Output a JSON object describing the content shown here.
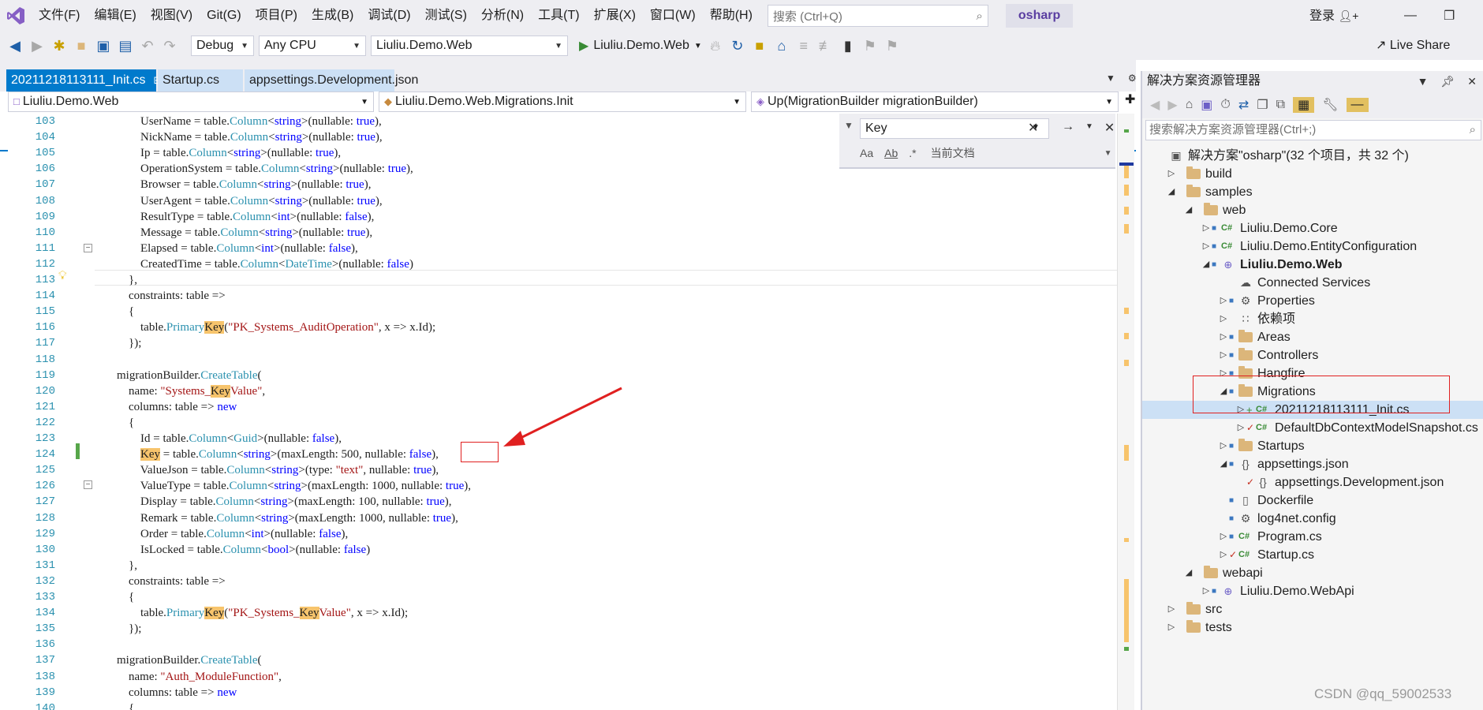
{
  "menu": {
    "items": [
      "文件(F)",
      "编辑(E)",
      "视图(V)",
      "Git(G)",
      "项目(P)",
      "生成(B)",
      "调试(D)",
      "测试(S)",
      "分析(N)",
      "工具(T)",
      "扩展(X)",
      "窗口(W)",
      "帮助(H)"
    ],
    "search_placeholder": "搜索 (Ctrl+Q)",
    "solution_name": "osharp",
    "login": "登录"
  },
  "toolbar": {
    "config": "Debug",
    "platform": "Any CPU",
    "startup_project": "Liuliu.Demo.Web",
    "run_target": "Liuliu.Demo.Web",
    "live_share": "Live Share"
  },
  "tabs": [
    {
      "label": "20211218113111_Init.cs",
      "active": true
    },
    {
      "label": "Startup.cs",
      "active": false
    },
    {
      "label": "appsettings.Development.json",
      "active": false
    }
  ],
  "navbar": {
    "project": "Liuliu.Demo.Web",
    "type": "Liuliu.Demo.Web.Migrations.Init",
    "member": "Up(MigrationBuilder migrationBuilder)"
  },
  "find": {
    "query": "Key",
    "scope": "当前文档"
  },
  "code": {
    "line_numbers": [
      "103",
      "104",
      "105",
      "106",
      "107",
      "108",
      "109",
      "110",
      "111",
      "112",
      "113",
      "114",
      "115",
      "116",
      "117",
      "118",
      "119",
      "120",
      "121",
      "122",
      "123",
      "124",
      "125",
      "126",
      "127",
      "128",
      "129",
      "130",
      "131",
      "132",
      "133",
      "134",
      "135",
      "136",
      "137",
      "138",
      "139",
      "140"
    ],
    "lines": [
      [
        {
          "t": "                UserName = table.",
          "c": ""
        },
        {
          "t": "Column",
          "c": "ty"
        },
        {
          "t": "<",
          "c": ""
        },
        {
          "t": "string",
          "c": "kw"
        },
        {
          "t": ">(nullable: ",
          "c": ""
        },
        {
          "t": "true",
          "c": "kw"
        },
        {
          "t": "),",
          "c": ""
        }
      ],
      [
        {
          "t": "                NickName = table.",
          "c": ""
        },
        {
          "t": "Column",
          "c": "ty"
        },
        {
          "t": "<",
          "c": ""
        },
        {
          "t": "string",
          "c": "kw"
        },
        {
          "t": ">(nullable: ",
          "c": ""
        },
        {
          "t": "true",
          "c": "kw"
        },
        {
          "t": "),",
          "c": ""
        }
      ],
      [
        {
          "t": "                Ip = table.",
          "c": ""
        },
        {
          "t": "Column",
          "c": "ty"
        },
        {
          "t": "<",
          "c": ""
        },
        {
          "t": "string",
          "c": "kw"
        },
        {
          "t": ">(nullable: ",
          "c": ""
        },
        {
          "t": "true",
          "c": "kw"
        },
        {
          "t": "),",
          "c": ""
        }
      ],
      [
        {
          "t": "                OperationSystem = table.",
          "c": ""
        },
        {
          "t": "Column",
          "c": "ty"
        },
        {
          "t": "<",
          "c": ""
        },
        {
          "t": "string",
          "c": "kw"
        },
        {
          "t": ">(nullable: ",
          "c": ""
        },
        {
          "t": "true",
          "c": "kw"
        },
        {
          "t": "),",
          "c": ""
        }
      ],
      [
        {
          "t": "                Browser = table.",
          "c": ""
        },
        {
          "t": "Column",
          "c": "ty"
        },
        {
          "t": "<",
          "c": ""
        },
        {
          "t": "string",
          "c": "kw"
        },
        {
          "t": ">(nullable: ",
          "c": ""
        },
        {
          "t": "true",
          "c": "kw"
        },
        {
          "t": "),",
          "c": ""
        }
      ],
      [
        {
          "t": "                UserAgent = table.",
          "c": ""
        },
        {
          "t": "Column",
          "c": "ty"
        },
        {
          "t": "<",
          "c": ""
        },
        {
          "t": "string",
          "c": "kw"
        },
        {
          "t": ">(nullable: ",
          "c": ""
        },
        {
          "t": "true",
          "c": "kw"
        },
        {
          "t": "),",
          "c": ""
        }
      ],
      [
        {
          "t": "                ResultType = table.",
          "c": ""
        },
        {
          "t": "Column",
          "c": "ty"
        },
        {
          "t": "<",
          "c": ""
        },
        {
          "t": "int",
          "c": "kw"
        },
        {
          "t": ">(nullable: ",
          "c": ""
        },
        {
          "t": "false",
          "c": "kw"
        },
        {
          "t": "),",
          "c": ""
        }
      ],
      [
        {
          "t": "                Message = table.",
          "c": ""
        },
        {
          "t": "Column",
          "c": "ty"
        },
        {
          "t": "<",
          "c": ""
        },
        {
          "t": "string",
          "c": "kw"
        },
        {
          "t": ">(nullable: ",
          "c": ""
        },
        {
          "t": "true",
          "c": "kw"
        },
        {
          "t": "),",
          "c": ""
        }
      ],
      [
        {
          "t": "                Elapsed = table.",
          "c": ""
        },
        {
          "t": "Column",
          "c": "ty"
        },
        {
          "t": "<",
          "c": ""
        },
        {
          "t": "int",
          "c": "kw"
        },
        {
          "t": ">(nullable: ",
          "c": ""
        },
        {
          "t": "false",
          "c": "kw"
        },
        {
          "t": "),",
          "c": ""
        }
      ],
      [
        {
          "t": "                CreatedTime = table.",
          "c": ""
        },
        {
          "t": "Column",
          "c": "ty"
        },
        {
          "t": "<",
          "c": ""
        },
        {
          "t": "DateTime",
          "c": "ty"
        },
        {
          "t": ">(nullable: ",
          "c": ""
        },
        {
          "t": "false",
          "c": "kw"
        },
        {
          "t": ")",
          "c": ""
        }
      ],
      [
        {
          "t": "            },",
          "c": ""
        }
      ],
      [
        {
          "t": "            constraints: table =>",
          "c": ""
        }
      ],
      [
        {
          "t": "            {",
          "c": ""
        }
      ],
      [
        {
          "t": "                table.",
          "c": ""
        },
        {
          "t": "Primary",
          "c": "ty"
        },
        {
          "t": "Key",
          "c": "hl"
        },
        {
          "t": "(",
          "c": ""
        },
        {
          "t": "\"PK_Systems_AuditOperation\"",
          "c": "st"
        },
        {
          "t": ", x => x.Id);",
          "c": ""
        }
      ],
      [
        {
          "t": "            });",
          "c": ""
        }
      ],
      [
        {
          "t": "",
          "c": ""
        }
      ],
      [
        {
          "t": "        migrationBuilder.",
          "c": ""
        },
        {
          "t": "CreateTable",
          "c": "ty"
        },
        {
          "t": "(",
          "c": ""
        }
      ],
      [
        {
          "t": "            name: ",
          "c": ""
        },
        {
          "t": "\"Systems_",
          "c": "st"
        },
        {
          "t": "Key",
          "c": "hl"
        },
        {
          "t": "Value\"",
          "c": "st"
        },
        {
          "t": ",",
          "c": ""
        }
      ],
      [
        {
          "t": "            columns: table => ",
          "c": ""
        },
        {
          "t": "new",
          "c": "kw"
        }
      ],
      [
        {
          "t": "            {",
          "c": ""
        }
      ],
      [
        {
          "t": "                Id = table.",
          "c": ""
        },
        {
          "t": "Column",
          "c": "ty"
        },
        {
          "t": "<",
          "c": ""
        },
        {
          "t": "Guid",
          "c": "ty"
        },
        {
          "t": ">(nullable: ",
          "c": ""
        },
        {
          "t": "false",
          "c": "kw"
        },
        {
          "t": "),",
          "c": ""
        }
      ],
      [
        {
          "t": "                ",
          "c": ""
        },
        {
          "t": "Key",
          "c": "hl"
        },
        {
          "t": " = table.",
          "c": ""
        },
        {
          "t": "Column",
          "c": "ty"
        },
        {
          "t": "<",
          "c": ""
        },
        {
          "t": "string",
          "c": "kw"
        },
        {
          "t": ">(maxLength: 500, nullable: ",
          "c": ""
        },
        {
          "t": "false",
          "c": "kw"
        },
        {
          "t": "),",
          "c": ""
        }
      ],
      [
        {
          "t": "                ValueJson = table.",
          "c": ""
        },
        {
          "t": "Column",
          "c": "ty"
        },
        {
          "t": "<",
          "c": ""
        },
        {
          "t": "string",
          "c": "kw"
        },
        {
          "t": ">(type: ",
          "c": ""
        },
        {
          "t": "\"text\"",
          "c": "st"
        },
        {
          "t": ", nullable: ",
          "c": ""
        },
        {
          "t": "true",
          "c": "kw"
        },
        {
          "t": "),",
          "c": ""
        }
      ],
      [
        {
          "t": "                ValueType = table.",
          "c": ""
        },
        {
          "t": "Column",
          "c": "ty"
        },
        {
          "t": "<",
          "c": ""
        },
        {
          "t": "string",
          "c": "kw"
        },
        {
          "t": ">(maxLength: 1000, nullable: ",
          "c": ""
        },
        {
          "t": "true",
          "c": "kw"
        },
        {
          "t": "),",
          "c": ""
        }
      ],
      [
        {
          "t": "                Display = table.",
          "c": ""
        },
        {
          "t": "Column",
          "c": "ty"
        },
        {
          "t": "<",
          "c": ""
        },
        {
          "t": "string",
          "c": "kw"
        },
        {
          "t": ">(maxLength: 100, nullable: ",
          "c": ""
        },
        {
          "t": "true",
          "c": "kw"
        },
        {
          "t": "),",
          "c": ""
        }
      ],
      [
        {
          "t": "                Remark = table.",
          "c": ""
        },
        {
          "t": "Column",
          "c": "ty"
        },
        {
          "t": "<",
          "c": ""
        },
        {
          "t": "string",
          "c": "kw"
        },
        {
          "t": ">(maxLength: 1000, nullable: ",
          "c": ""
        },
        {
          "t": "true",
          "c": "kw"
        },
        {
          "t": "),",
          "c": ""
        }
      ],
      [
        {
          "t": "                Order = table.",
          "c": ""
        },
        {
          "t": "Column",
          "c": "ty"
        },
        {
          "t": "<",
          "c": ""
        },
        {
          "t": "int",
          "c": "kw"
        },
        {
          "t": ">(nullable: ",
          "c": ""
        },
        {
          "t": "false",
          "c": "kw"
        },
        {
          "t": "),",
          "c": ""
        }
      ],
      [
        {
          "t": "                IsLocked = table.",
          "c": ""
        },
        {
          "t": "Column",
          "c": "ty"
        },
        {
          "t": "<",
          "c": ""
        },
        {
          "t": "bool",
          "c": "kw"
        },
        {
          "t": ">(nullable: ",
          "c": ""
        },
        {
          "t": "false",
          "c": "kw"
        },
        {
          "t": ")",
          "c": ""
        }
      ],
      [
        {
          "t": "            },",
          "c": ""
        }
      ],
      [
        {
          "t": "            constraints: table =>",
          "c": ""
        }
      ],
      [
        {
          "t": "            {",
          "c": ""
        }
      ],
      [
        {
          "t": "                table.",
          "c": ""
        },
        {
          "t": "Primary",
          "c": "ty"
        },
        {
          "t": "Key",
          "c": "hl"
        },
        {
          "t": "(",
          "c": ""
        },
        {
          "t": "\"PK_Systems_",
          "c": "st"
        },
        {
          "t": "Key",
          "c": "hl"
        },
        {
          "t": "Value\"",
          "c": "st"
        },
        {
          "t": ", x => x.Id);",
          "c": ""
        }
      ],
      [
        {
          "t": "            });",
          "c": ""
        }
      ],
      [
        {
          "t": "",
          "c": ""
        }
      ],
      [
        {
          "t": "        migrationBuilder.",
          "c": ""
        },
        {
          "t": "CreateTable",
          "c": "ty"
        },
        {
          "t": "(",
          "c": ""
        }
      ],
      [
        {
          "t": "            name: ",
          "c": ""
        },
        {
          "t": "\"Auth_ModuleFunction\"",
          "c": "st"
        },
        {
          "t": ",",
          "c": ""
        }
      ],
      [
        {
          "t": "            columns: table => ",
          "c": ""
        },
        {
          "t": "new",
          "c": "kw"
        }
      ],
      [
        {
          "t": "            {",
          "c": ""
        }
      ]
    ]
  },
  "solution_explorer": {
    "title": "解决方案资源管理器",
    "search_placeholder": "搜索解决方案资源管理器(Ctrl+;)",
    "nodes": [
      {
        "label": "解决方案\"osharp\"(32 个项目，共 32 个)",
        "depth": 0,
        "expander": "",
        "icon": "solution",
        "bold": false
      },
      {
        "label": "build",
        "depth": 1,
        "expander": "collapsed",
        "icon": "folder"
      },
      {
        "label": "samples",
        "depth": 1,
        "expander": "expanded",
        "icon": "folder"
      },
      {
        "label": "web",
        "depth": 2,
        "expander": "expanded",
        "icon": "folder"
      },
      {
        "label": "Liuliu.Demo.Core",
        "depth": 3,
        "expander": "collapsed",
        "icon": "csproj",
        "lock": true
      },
      {
        "label": "Liuliu.Demo.EntityConfiguration",
        "depth": 3,
        "expander": "collapsed",
        "icon": "csproj",
        "lock": true
      },
      {
        "label": "Liuliu.Demo.Web",
        "depth": 3,
        "expander": "expanded",
        "icon": "webproj",
        "lock": true,
        "bold": true
      },
      {
        "label": "Connected Services",
        "depth": 4,
        "expander": "",
        "icon": "connected"
      },
      {
        "label": "Properties",
        "depth": 4,
        "expander": "collapsed",
        "icon": "gear",
        "lock": true
      },
      {
        "label": "依赖项",
        "depth": 4,
        "expander": "collapsed",
        "icon": "deps"
      },
      {
        "label": "Areas",
        "depth": 4,
        "expander": "collapsed",
        "icon": "folder",
        "lock": true
      },
      {
        "label": "Controllers",
        "depth": 4,
        "expander": "collapsed",
        "icon": "folder",
        "lock": true
      },
      {
        "label": "Hangfire",
        "depth": 4,
        "expander": "collapsed",
        "icon": "folder",
        "lock": true
      },
      {
        "label": "Migrations",
        "depth": 4,
        "expander": "expanded",
        "icon": "folder",
        "lock": true
      },
      {
        "label": "20211218113111_Init.cs",
        "depth": 5,
        "expander": "collapsed",
        "icon": "cs",
        "mark": "plus",
        "selected": true
      },
      {
        "label": "DefaultDbContextModelSnapshot.cs",
        "depth": 5,
        "expander": "collapsed",
        "icon": "cs",
        "mark": "check"
      },
      {
        "label": "Startups",
        "depth": 4,
        "expander": "collapsed",
        "icon": "folder",
        "lock": true
      },
      {
        "label": "appsettings.json",
        "depth": 4,
        "expander": "expanded",
        "icon": "json",
        "lock": true
      },
      {
        "label": "appsettings.Development.json",
        "depth": 5,
        "expander": "",
        "icon": "json",
        "mark": "check"
      },
      {
        "label": "Dockerfile",
        "depth": 4,
        "expander": "",
        "icon": "file",
        "lock": true
      },
      {
        "label": "log4net.config",
        "depth": 4,
        "expander": "",
        "icon": "config",
        "lock": true
      },
      {
        "label": "Program.cs",
        "depth": 4,
        "expander": "collapsed",
        "icon": "cs",
        "lock": true
      },
      {
        "label": "Startup.cs",
        "depth": 4,
        "expander": "collapsed",
        "icon": "cs",
        "mark": "check"
      },
      {
        "label": "webapi",
        "depth": 2,
        "expander": "expanded",
        "icon": "folder"
      },
      {
        "label": "Liuliu.Demo.WebApi",
        "depth": 3,
        "expander": "collapsed",
        "icon": "webproj",
        "lock": true
      },
      {
        "label": "src",
        "depth": 1,
        "expander": "collapsed",
        "icon": "folder"
      },
      {
        "label": "tests",
        "depth": 1,
        "expander": "collapsed",
        "icon": "folder"
      }
    ]
  },
  "watermark": "CSDN @qq_59002533",
  "colors": {
    "accent": "#007acc",
    "keyword": "#0000ff",
    "type": "#2b91af",
    "string": "#a31515",
    "highlight": "#f7c46c",
    "annotation": "#e02020"
  }
}
